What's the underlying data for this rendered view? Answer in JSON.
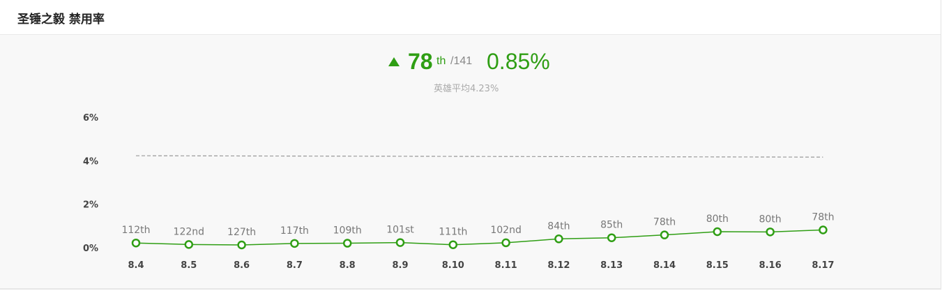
{
  "header": {
    "title": "圣锤之毅 禁用率"
  },
  "summary": {
    "rank": "78",
    "rank_suffix": "th",
    "rank_total": "/141",
    "rate": "0.85%",
    "average_text": "英雄平均4.23%"
  },
  "colors": {
    "accent": "#2f9e14",
    "avg_line": "#999999",
    "background": "#f8f8f8"
  },
  "chart_data": {
    "type": "line",
    "title": "",
    "xlabel": "",
    "ylabel": "",
    "x": [
      "8.4",
      "8.5",
      "8.6",
      "8.7",
      "8.8",
      "8.9",
      "8.10",
      "8.11",
      "8.12",
      "8.13",
      "8.14",
      "8.15",
      "8.16",
      "8.17"
    ],
    "ylim": [
      0,
      6
    ],
    "yticks": [
      "6%",
      "4%",
      "2%",
      "0%"
    ],
    "ytick_values": [
      6,
      4,
      2,
      0
    ],
    "series": [
      {
        "values": [
          0.25,
          0.18,
          0.16,
          0.23,
          0.24,
          0.27,
          0.17,
          0.26,
          0.44,
          0.49,
          0.62,
          0.77,
          0.76,
          0.85
        ],
        "point_labels": [
          "112th",
          "122nd",
          "127th",
          "117th",
          "109th",
          "101st",
          "111th",
          "102nd",
          "84th",
          "85th",
          "78th",
          "80th",
          "80th",
          "78th"
        ]
      }
    ],
    "reference_line": {
      "value": 4.23,
      "style": "dashed"
    },
    "grid": false,
    "legend": "none"
  }
}
